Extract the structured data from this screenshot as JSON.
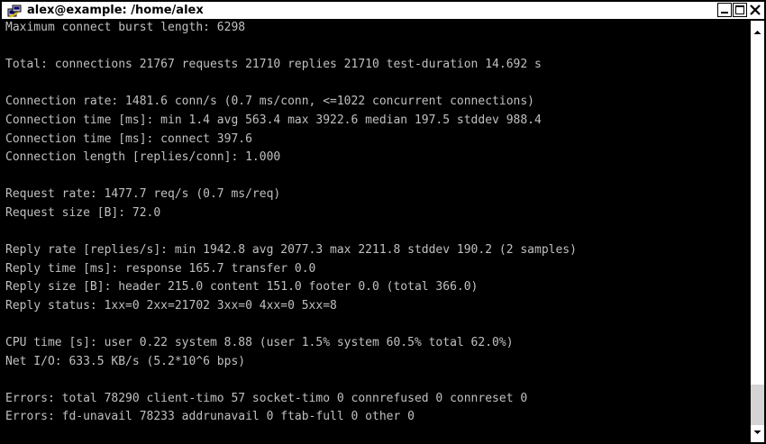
{
  "window": {
    "title": "alex@example: /home/alex",
    "icons": {
      "app": "putty-terminal-icon",
      "minimize": "minimize-icon",
      "maximize": "maximize-icon",
      "close": "close-icon"
    }
  },
  "colors": {
    "terminal_bg": "#000000",
    "terminal_fg": "#c0c0c0",
    "titlebar_bg": "#ffffff",
    "title_fg": "#000000"
  },
  "terminal": {
    "lines": [
      "Maximum connect burst length: 6298",
      "",
      "Total: connections 21767 requests 21710 replies 21710 test-duration 14.692 s",
      "",
      "Connection rate: 1481.6 conn/s (0.7 ms/conn, <=1022 concurrent connections)",
      "Connection time [ms]: min 1.4 avg 563.4 max 3922.6 median 197.5 stddev 988.4",
      "Connection time [ms]: connect 397.6",
      "Connection length [replies/conn]: 1.000",
      "",
      "Request rate: 1477.7 req/s (0.7 ms/req)",
      "Request size [B]: 72.0",
      "",
      "Reply rate [replies/s]: min 1942.8 avg 2077.3 max 2211.8 stddev 190.2 (2 samples)",
      "Reply time [ms]: response 165.7 transfer 0.0",
      "Reply size [B]: header 215.0 content 151.0 footer 0.0 (total 366.0)",
      "Reply status: 1xx=0 2xx=21702 3xx=0 4xx=0 5xx=8",
      "",
      "CPU time [s]: user 0.22 system 8.88 (user 1.5% system 60.5% total 62.0%)",
      "Net I/O: 633.5 KB/s (5.2*10^6 bps)",
      "",
      "Errors: total 78290 client-timo 57 socket-timo 0 connrefused 0 connreset 0",
      "Errors: fd-unavail 78233 addrunavail 0 ftab-full 0 other 0"
    ]
  },
  "scrollbar": {
    "up_icon": "scroll-up-arrow-icon",
    "down_icon": "scroll-down-arrow-icon",
    "position_fraction": 0.95
  }
}
